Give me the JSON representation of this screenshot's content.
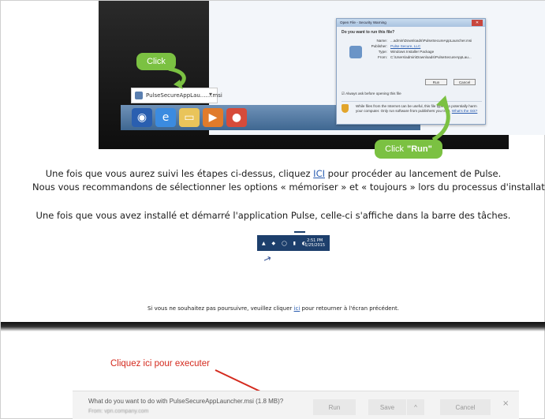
{
  "top_screenshot": {
    "click_callout": "Click",
    "download_item": "PulseSecureAppLau.......msi",
    "run_callout_prefix": "Click",
    "run_callout_bold": "\"Run\"",
    "security_dialog": {
      "title": "Open File - Security Warning",
      "question": "Do you want to run this file?",
      "rows": [
        {
          "label": "Name:",
          "value": "...admin\\Downloads\\PulseSecureAppLauncher.msi"
        },
        {
          "label": "Publisher:",
          "value": "Pulse Secure, LLC"
        },
        {
          "label": "Type:",
          "value": "Windows Installer Package"
        },
        {
          "label": "From:",
          "value": "C:\\Users\\admin\\Downloads\\PulseSecureAppLau..."
        }
      ],
      "run_button": "Run",
      "cancel_button": "Cancel",
      "checkbox_label": "Always ask before opening this file",
      "warning_text": "While files from the Internet can be useful, this file type can potentially harm your computer. Only run software from publishers you trust.",
      "warning_link": "What's the risk?"
    }
  },
  "instructions": {
    "line1_before": "Une fois que vous aurez suivi les étapes ci-dessus, cliquez ",
    "line1_link": "ICI",
    "line1_after": " pour procéder au lancement de Pulse.",
    "line2": "Nous vous recommandons de sélectionner les options « mémoriser » et « toujours » lors du processus d'installation",
    "line3": "Une fois que vous avez installé et démarré l'application Pulse, celle-ci s'affiche dans la barre des tâches.",
    "tray_time": "2:51 PM",
    "tray_date": "1/25/2015",
    "line4_before": "Si vous ne souhaitez pas poursuivre, veuillez cliquer ",
    "line4_link": "ici",
    "line4_after": " pour retourner à l'écran précédent."
  },
  "bottom_area": {
    "execute_label": "Cliquez ici pour executer",
    "ie_bar": {
      "question": "What do you want to do with PulseSecureAppLauncher.msi (1.8 MB)?",
      "from": "From: vpn.company.com",
      "run": "Run",
      "save": "Save",
      "save_arrow": "^",
      "cancel": "Cancel",
      "close": "×"
    }
  },
  "colors": {
    "callout_green": "#7bc142",
    "link_blue": "#2a5db0",
    "annotation_red": "#d42a1e",
    "tray_blue": "#1d3f6c"
  }
}
